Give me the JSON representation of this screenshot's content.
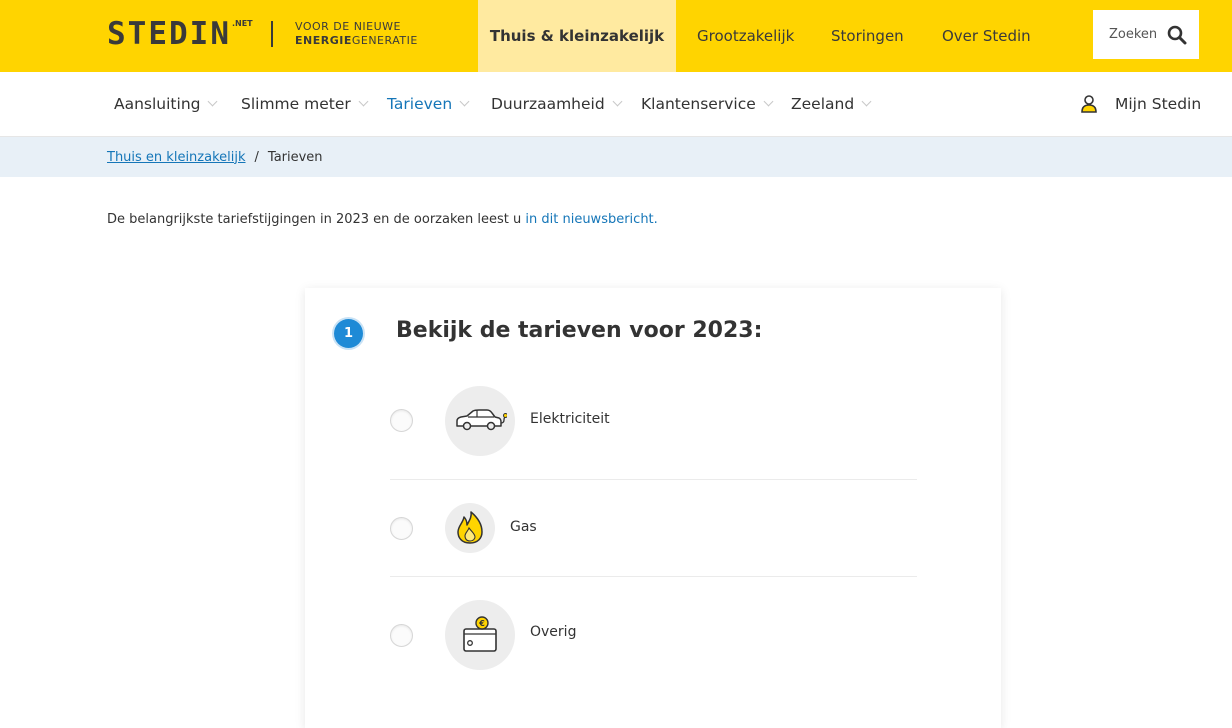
{
  "brand": {
    "logo_word": "STEDIN",
    "logo_suffix": ".NET",
    "tagline_line1": "VOOR DE NIEUWE",
    "tagline_bold": "ENERGIE",
    "tagline_rest": "GENERATIE"
  },
  "topnav": {
    "active": "Thuis & kleinzakelijk",
    "items": [
      "Grootzakelijk",
      "Storingen",
      "Over Stedin"
    ]
  },
  "search": {
    "label": "Zoeken",
    "icon": "search-icon"
  },
  "subnav": {
    "items": [
      "Aansluiting",
      "Slimme meter",
      "Tarieven",
      "Duurzaamheid",
      "Klantenservice",
      "Zeeland"
    ],
    "active": "Tarieven",
    "account": "Mijn Stedin",
    "account_icon": "user-icon"
  },
  "breadcrumb": {
    "parent": "Thuis en kleinzakelijk",
    "separator": "/",
    "current": "Tarieven"
  },
  "intro": {
    "text": "De belangrijkste tariefstijgingen in 2023 en de oorzaken leest u ",
    "link": "in dit nieuwsbericht."
  },
  "card": {
    "step": "1",
    "title": "Bekijk de tarieven voor 2023:",
    "options": [
      {
        "label": "Elektriciteit",
        "icon": "electric-car-icon"
      },
      {
        "label": "Gas",
        "icon": "flame-icon"
      },
      {
        "label": "Overig",
        "icon": "wallet-euro-icon"
      }
    ]
  },
  "colors": {
    "brand_yellow": "#ffd400",
    "active_tab": "#ffeaa0",
    "link_blue": "#1576b8",
    "breadcrumb_bg": "#e8f0f7",
    "step_blue": "#1e8ad6"
  }
}
